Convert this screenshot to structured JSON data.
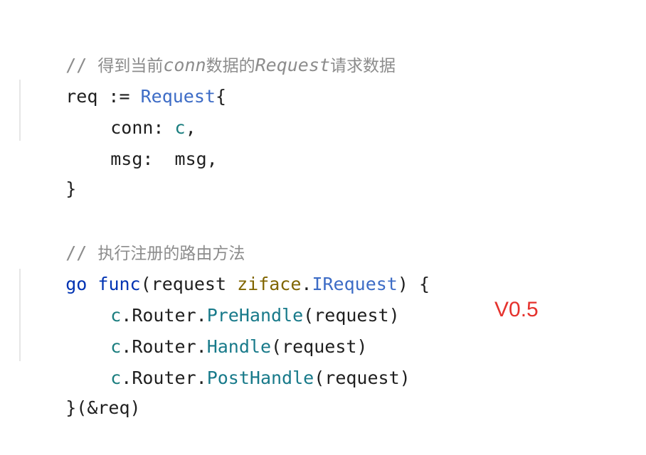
{
  "code": {
    "comment1": {
      "slashes": "// ",
      "part1": "得到当前",
      "italic1": "conn",
      "part2": "数据的",
      "italic2": "Request",
      "part3": "请求数据"
    },
    "line2": {
      "var": "req",
      "op": " := ",
      "type": "Request",
      "brace": "{"
    },
    "line3": {
      "field": "conn: ",
      "value": "c",
      "tail": ","
    },
    "line4": {
      "field": "msg:  msg,"
    },
    "line5": {
      "brace": "}"
    },
    "comment2": {
      "slashes": "// ",
      "text": "执行注册的路由方法"
    },
    "line7": {
      "go": "go",
      "func": "func",
      "open": "(request ",
      "pkg": "ziface",
      "dot": ".",
      "type": "IRequest",
      "close": ") {"
    },
    "line8": {
      "recv": "c",
      "mid": ".Router.",
      "method": "PreHandle",
      "args": "(request)"
    },
    "line9": {
      "recv": "c",
      "mid": ".Router.",
      "method": "Handle",
      "args": "(request)"
    },
    "line10": {
      "recv": "c",
      "mid": ".Router.",
      "method": "PostHandle",
      "args": "(request)"
    },
    "line11": {
      "text": "}(&req)"
    }
  },
  "version_label": "V0.5"
}
